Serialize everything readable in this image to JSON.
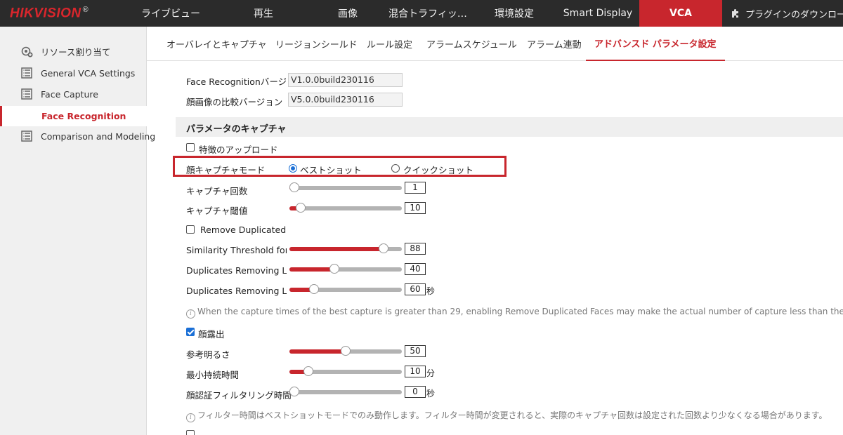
{
  "brand": {
    "logo": "HIKVISION",
    "mark": "®"
  },
  "nav": [
    {
      "label": "ライブビュー",
      "active": false
    },
    {
      "label": "再生",
      "active": false
    },
    {
      "label": "画像",
      "active": false
    },
    {
      "label": "混合トラフィッ…",
      "active": false
    },
    {
      "label": "環境設定",
      "active": false
    },
    {
      "label": "Smart Display",
      "active": false
    },
    {
      "label": "VCA",
      "active": true
    }
  ],
  "plugin": {
    "label": "プラグインのダウンロード",
    "icon": "puzzle-icon"
  },
  "sidebar": {
    "items": [
      {
        "label": "リソース割り当て",
        "icon": "resource-icon"
      },
      {
        "label": "General VCA Settings",
        "icon": "grid-icon"
      },
      {
        "label": "Face Capture",
        "icon": "grid-icon"
      },
      {
        "label": "Face Recognition",
        "active": true
      },
      {
        "label": "Comparison and Modeling",
        "icon": "grid-icon"
      }
    ]
  },
  "tabs": [
    {
      "label": "オーバレイとキャプチャ",
      "active": false
    },
    {
      "label": "リージョンシールド",
      "active": false
    },
    {
      "label": "ルール設定",
      "active": false
    },
    {
      "label": "アラームスケジュール",
      "active": false
    },
    {
      "label": "アラーム連動",
      "active": false
    },
    {
      "label": "アドバンスド パラメータ設定",
      "active": true
    }
  ],
  "info": {
    "face_recog_version_label": "Face Recognitionバージ…",
    "face_recog_version_value": "V1.0.0build230116",
    "compare_version_label": "顔画像の比較バージョン",
    "compare_version_value": "V5.0.0build230116"
  },
  "section_title": "パラメータのキャプチャ",
  "feature_upload": {
    "label": "特徴のアップロード",
    "checked": false
  },
  "capture_mode": {
    "label": "顔キャプチャモード",
    "options": [
      {
        "label": "ベストショット",
        "selected": true
      },
      {
        "label": "クイックショット",
        "selected": false
      }
    ]
  },
  "sliders": [
    {
      "key": "capture_count",
      "label": "キャプチャ回数",
      "value": "1",
      "unit": "",
      "fraction": 0.0
    },
    {
      "key": "capture_threshold",
      "label": "キャプチャ閾値",
      "value": "10",
      "unit": "",
      "fraction": 0.1
    },
    {
      "key": "similarity_threshold",
      "label": "Similarity Threshold for D…",
      "value": "88",
      "unit": "",
      "fraction": 0.84
    },
    {
      "key": "dup_remove_1",
      "label": "Duplicates Removing Libr…",
      "value": "40",
      "unit": "",
      "fraction": 0.4
    },
    {
      "key": "dup_remove_2",
      "label": "Duplicates Removing Libr…",
      "value": "60",
      "unit": "秒",
      "fraction": 0.22
    },
    {
      "key": "ref_brightness",
      "label": "参考明るさ",
      "value": "50",
      "unit": "",
      "fraction": 0.5
    },
    {
      "key": "min_duration",
      "label": "最小持続時間",
      "value": "10",
      "unit": "分",
      "fraction": 0.17
    },
    {
      "key": "filter_time",
      "label": "顔認証フィルタリング時間",
      "value": "0",
      "unit": "秒",
      "fraction": 0.0
    }
  ],
  "remove_duplicated": {
    "label": "Remove Duplicated F…",
    "checked": false
  },
  "note_duplicates": "When the capture times of the best capture is greater than 29, enabling Remove Duplicated Faces may make the actual number of capture less than the set one.",
  "face_exposure": {
    "label": "顔露出",
    "checked": true
  },
  "note_filter": "フィルター時間はベストショットモードでのみ動作します。フィルター時間が変更されると、実際のキャプチャ回数は設定された回数より少なくなる場合があります。",
  "colors": {
    "accent": "#c8262d",
    "topbar": "#2b2b2b",
    "check": "#1a6fd6"
  }
}
